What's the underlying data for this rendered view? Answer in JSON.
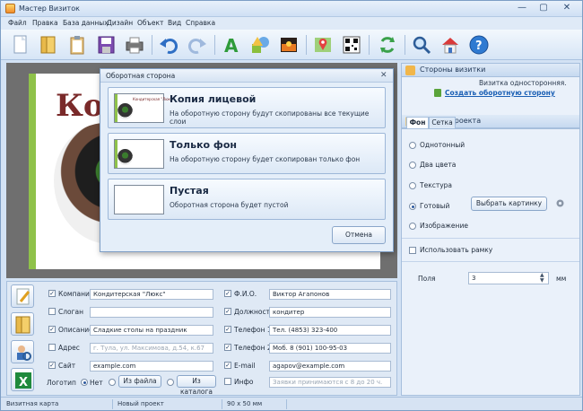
{
  "window": {
    "title": "Мастер Визиток",
    "controls": [
      "—",
      "▢",
      "✕"
    ]
  },
  "menu": [
    "Файл",
    "Правка",
    "База данных",
    "Дизайн",
    "Объект",
    "Вид",
    "Справка"
  ],
  "toolbar_icons": [
    "new-file-icon",
    "open-folder-icon",
    "clipboard-icon",
    "save-icon",
    "print-icon",
    "undo-icon",
    "redo-icon",
    "text-icon",
    "shapes-icon",
    "image-icon",
    "map-icon",
    "qr-code-icon",
    "refresh-icon",
    "zoom-icon",
    "home-icon",
    "help-icon"
  ],
  "canvas": {
    "card_heading": "Ко"
  },
  "right_panel": {
    "sides_title": "Стороны визитки",
    "sides_info": "Визитка односторонняя.",
    "sides_link": "Создать оборотную сторону",
    "design_title": "Дизайн проекта",
    "tabs": [
      "Фон",
      "Сетка"
    ],
    "options": {
      "solid": "Однотонный",
      "two_colors": "Два цвета",
      "texture": "Текстура",
      "ready": "Готовый",
      "image": "Изображение"
    },
    "choose_picture": "Выбрать картинку",
    "use_frame": "Использовать рамку",
    "margins_label": "Поля",
    "margins_value": "3",
    "margins_unit": "мм"
  },
  "fields": {
    "company": {
      "label": "Компания",
      "value": "Кондитерская \"Люкс\""
    },
    "slogan": {
      "label": "Слоган",
      "value": ""
    },
    "description": {
      "label": "Описание",
      "value": "Сладкие столы на праздник"
    },
    "address": {
      "label": "Адрес",
      "value": "г. Тула, ул. Максимова, д.54, к.67"
    },
    "site": {
      "label": "Сайт",
      "value": "example.com"
    },
    "logo": {
      "label": "Логотип",
      "none": "Нет",
      "from_file": "Из файла",
      "from_catalog": "Из каталога"
    },
    "fio": {
      "label": "Ф.И.О.",
      "value": "Виктор Агапонов"
    },
    "position": {
      "label": "Должность",
      "value": "кондитер"
    },
    "phone1": {
      "label": "Телефон 1",
      "value": "Тел. (4853) 323-400"
    },
    "phone2": {
      "label": "Телефон 2",
      "value": "Моб. 8 (901) 100-95-03"
    },
    "email": {
      "label": "E-mail",
      "value": "agapov@example.com"
    },
    "info": {
      "label": "Инфо",
      "value": "Заявки принимаются с 8 до 20 ч."
    }
  },
  "dialog": {
    "title": "Оборотная сторона",
    "close": "✕",
    "options": [
      {
        "title": "Копия лицевой",
        "desc": "На оборотную сторону будут скопированы все текущие слои",
        "thumb_text": "Кондитерская \"Люкс\""
      },
      {
        "title": "Только фон",
        "desc": "На оборотную сторону будет скопирован только фон"
      },
      {
        "title": "Пустая",
        "desc": "Оборотная сторона будет пустой"
      }
    ],
    "cancel": "Отмена"
  },
  "status": {
    "left": "Визитная карта",
    "project": "Новый проект",
    "size": "90 x 50 мм"
  },
  "colors": {
    "accent_link": "#1a5fb4",
    "card_green": "#8fc24a",
    "heading_red": "#7a2a2a"
  }
}
